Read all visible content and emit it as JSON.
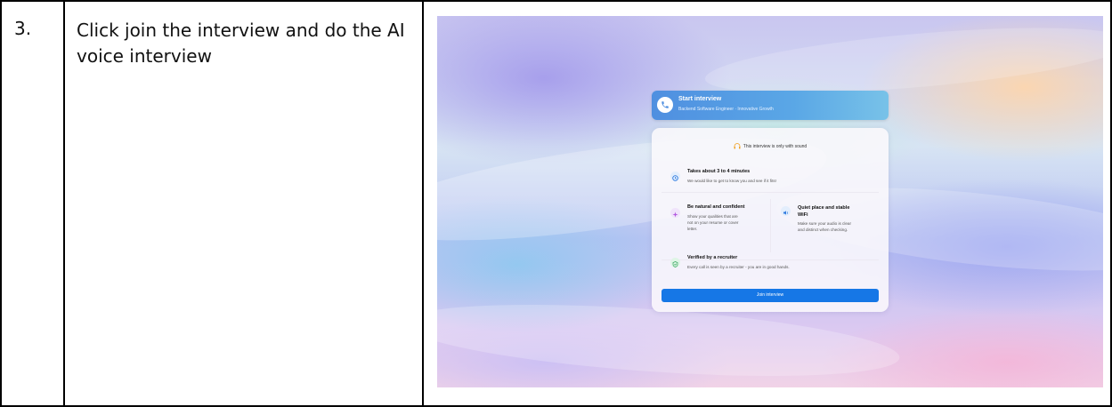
{
  "row": {
    "step_number": "3.",
    "instruction": "Click join the interview and do the AI voice interview"
  },
  "screenshot": {
    "header": {
      "title": "Start interview",
      "subtitle": "Backend Software Engineer · Innovative Growth",
      "icon": "phone-icon"
    },
    "sound_note": "This interview is only with sound",
    "items": {
      "duration": {
        "title": "Takes about 3 to 4 minutes",
        "text": "We would like to get to know you and see if it fits!",
        "icon": "clock-icon"
      },
      "natural": {
        "title": "Be natural and confident",
        "text_lines": [
          "Show your qualities that are",
          "not on your resume or cover",
          "letter."
        ],
        "icon": "sparkle-icon"
      },
      "quiet": {
        "title_lines": [
          "Quiet place and stable",
          "WiFi"
        ],
        "text_lines": [
          "Make sure your audio is clear",
          "and distinct when checking."
        ],
        "icon": "speaker-icon"
      },
      "verified": {
        "title": "Verified by a recruiter",
        "text": "Every call is seen by a recruiter - you are in good hands.",
        "icon": "shield-check-icon"
      }
    },
    "join_button": "Join interview",
    "colors": {
      "accent": "#1677e6",
      "header_gradient_start": "#4f8fe0",
      "header_gradient_end": "#78c2e8"
    }
  }
}
